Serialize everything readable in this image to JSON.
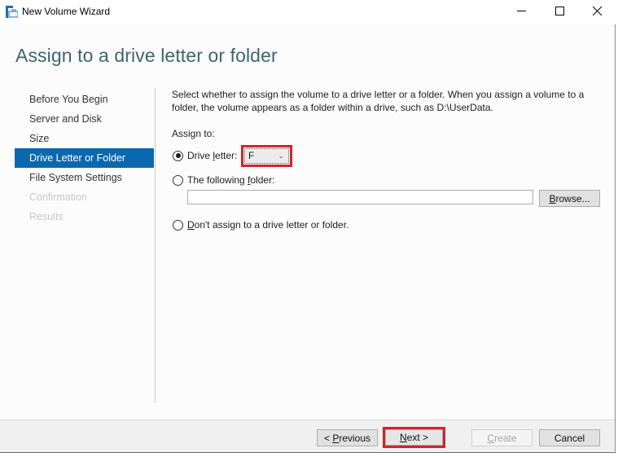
{
  "window": {
    "title": "New Volume Wizard",
    "icon": "volume-wizard-icon",
    "controls": {
      "minimize": "minimize-icon",
      "maximize": "maximize-icon",
      "close": "close-icon"
    }
  },
  "header": {
    "title": "Assign to a drive letter or folder"
  },
  "sidebar": {
    "steps": [
      {
        "label": "Before You Begin",
        "state": "normal"
      },
      {
        "label": "Server and Disk",
        "state": "normal"
      },
      {
        "label": "Size",
        "state": "normal"
      },
      {
        "label": "Drive Letter or Folder",
        "state": "active"
      },
      {
        "label": "File System Settings",
        "state": "normal"
      },
      {
        "label": "Confirmation",
        "state": "disabled"
      },
      {
        "label": "Results",
        "state": "disabled"
      }
    ]
  },
  "content": {
    "description": "Select whether to assign the volume to a drive letter or a folder. When you assign a volume to a folder, the volume appears as a folder within a drive, such as D:\\UserData.",
    "assign_label": "Assign to:",
    "options": {
      "drive_letter": {
        "label_pre": "Drive ",
        "label_accel": "l",
        "label_post": "etter:",
        "selected": true,
        "value": "F"
      },
      "folder": {
        "label_pre": "The following ",
        "label_accel": "f",
        "label_post": "older:",
        "selected": false,
        "value": "",
        "browse_accel": "B",
        "browse_rest": "rowse..."
      },
      "none": {
        "label_accel": "D",
        "label_post": "on't assign to a drive letter or folder.",
        "selected": false
      }
    }
  },
  "footer": {
    "previous": {
      "pre": "< ",
      "accel": "P",
      "post": "revious"
    },
    "next": {
      "accel": "N",
      "post": "ext >"
    },
    "create": {
      "accel": "C",
      "post": "reate",
      "enabled": false
    },
    "cancel": {
      "label": "Cancel"
    }
  },
  "colors": {
    "accent": "#0a68b0",
    "highlight": "#d0242c",
    "title_text": "#3f6470"
  }
}
